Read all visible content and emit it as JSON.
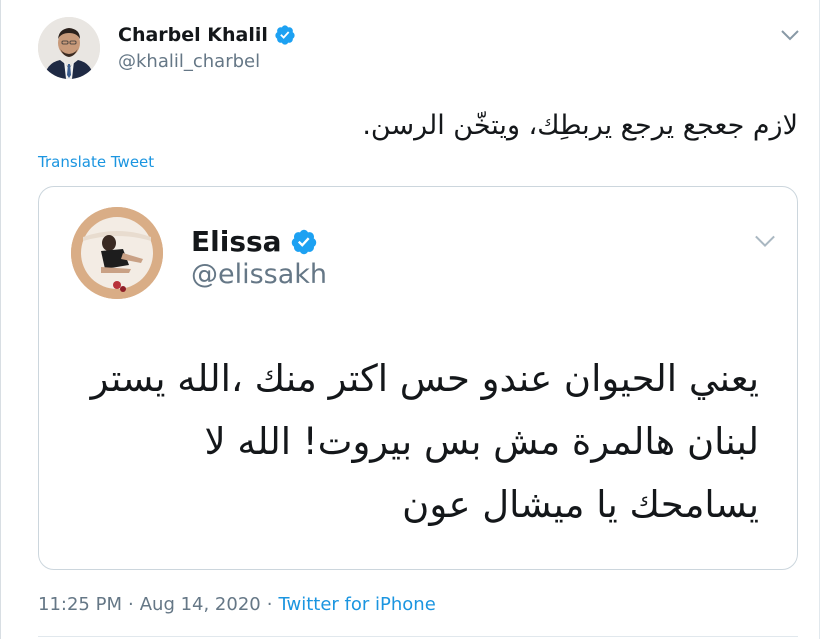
{
  "tweet": {
    "author_name": "Charbel Khalil",
    "author_handle": "@khalil_charbel",
    "text": "لازم جعجع يرجع يربطِك، ويتخّن الرسن.",
    "translate_label": "Translate Tweet",
    "time": "11:25 PM",
    "separator": "·",
    "date": "Aug 14, 2020",
    "source": "Twitter for iPhone"
  },
  "quoted": {
    "author_name": "Elissa",
    "author_handle": "@elissakh",
    "lines": [
      "يعني الحيوان عندو حس اكتر منك ،الله يستر",
      "لبنان هالمرة مش بس بيروت! الله لا",
      "يسامحك يا ميشال عون"
    ]
  },
  "icons": {
    "verified": "verified-badge-icon",
    "menu": "chevron-down-icon"
  },
  "colors": {
    "link": "#1b95e0",
    "verified": "#1da1f2",
    "secondary_text": "#657786",
    "border": "#ccd6dd"
  }
}
